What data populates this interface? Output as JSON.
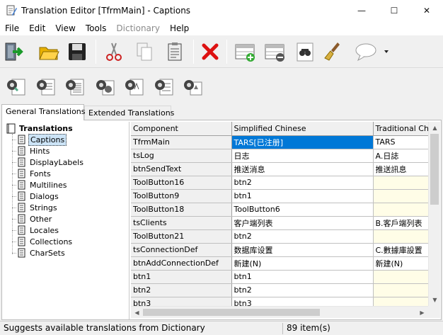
{
  "window": {
    "title": "Translation Editor [TfrmMain] - Captions",
    "controls": {
      "minimize": "—",
      "maximize": "☐",
      "close": "✕"
    }
  },
  "menu": [
    "File",
    "Edit",
    "View",
    "Tools",
    "Dictionary",
    "Help"
  ],
  "menu_disabled": [
    "Dictionary"
  ],
  "toolbar1_icons": [
    "exit-icon",
    "open-folder-icon",
    "save-icon",
    "cut-icon",
    "copy-icon",
    "paste-icon",
    "delete-icon",
    "add-row-icon",
    "remove-row-icon",
    "find-icon",
    "brush-icon",
    "comment-dropdown-icon"
  ],
  "toolbar2_icons": [
    "gear-page-1-icon",
    "gear-page-2-icon",
    "gear-page-3-icon",
    "gear-page-4-icon",
    "gear-page-5-icon",
    "gear-page-6-icon",
    "gear-page-7-icon"
  ],
  "tabs": {
    "general": "General Translations",
    "extended": "Extended Translations"
  },
  "tree": {
    "root": "Translations",
    "items": [
      "Captions",
      "Hints",
      "DisplayLabels",
      "Fonts",
      "Multilines",
      "Dialogs",
      "Strings",
      "Other",
      "Locales",
      "Collections",
      "CharSets"
    ],
    "selected": "Captions"
  },
  "grid": {
    "columns": [
      "Component",
      "Simplified Chinese",
      "Traditional Chi"
    ],
    "rows": [
      [
        "TfrmMain",
        "TARS[已注册]",
        "TARS"
      ],
      [
        "tsLog",
        "日志",
        "A.日誌"
      ],
      [
        "btnSendText",
        "推送消息",
        "推送訊息"
      ],
      [
        "ToolButton16",
        "btn2",
        ""
      ],
      [
        "ToolButton9",
        "btn1",
        ""
      ],
      [
        "ToolButton18",
        "ToolButton6",
        ""
      ],
      [
        "tsClients",
        "客户端列表",
        "B.客戶端列表"
      ],
      [
        "ToolButton21",
        "btn2",
        ""
      ],
      [
        "tsConnectionDef",
        "数据库设置",
        "C.數據庫設置"
      ],
      [
        "btnAddConnectionDef",
        "新建(N)",
        "新建(N)"
      ],
      [
        "btn1",
        "btn1",
        ""
      ],
      [
        "btn2",
        "btn2",
        ""
      ],
      [
        "btn3",
        "btn3",
        ""
      ]
    ]
  },
  "status": {
    "hint": "Suggests available translations from Dictionary",
    "count": "89 item(s)"
  }
}
